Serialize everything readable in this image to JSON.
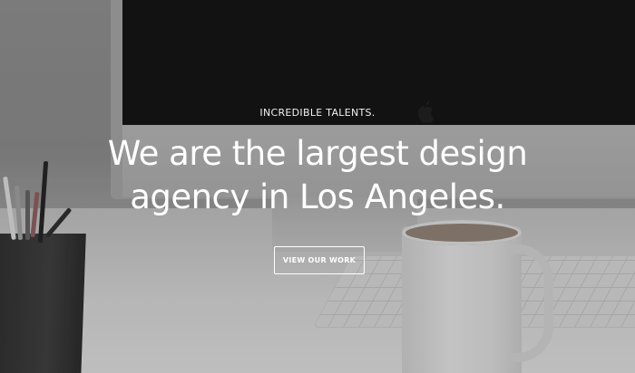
{
  "hero": {
    "eyebrow": "INCREDIBLE TALENTS.",
    "headline_line1": "We are the largest design",
    "headline_line2": "agency in Los Angeles.",
    "cta_label": "VIEW OUR WORK"
  },
  "background": {
    "scene": "desk-workspace",
    "icons": [
      "apple-logo-icon"
    ]
  },
  "colors": {
    "text": "#ffffff",
    "cta_border": "#ffffff"
  }
}
